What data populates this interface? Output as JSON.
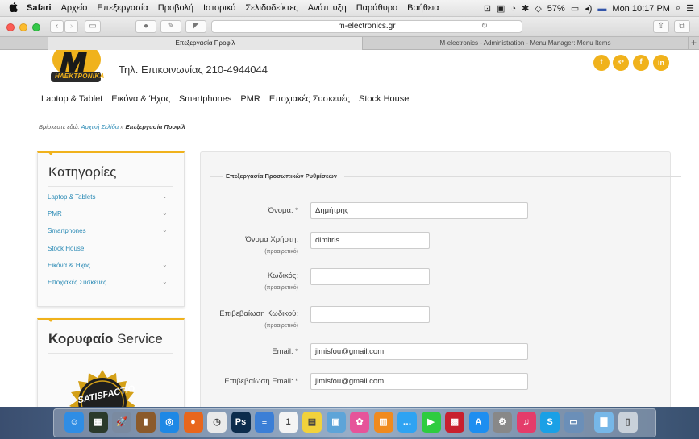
{
  "menubar": {
    "apple": "",
    "items": [
      "Safari",
      "Αρχείο",
      "Επεξεργασία",
      "Προβολή",
      "Ιστορικό",
      "Σελιδοδείκτες",
      "Ανάπτυξη",
      "Παράθυρο",
      "Βοήθεια"
    ],
    "battery": "57%",
    "clock": "Mon 10:17 PM"
  },
  "browser": {
    "url": "m-electronics.gr",
    "tabs": [
      {
        "label": "Επεξεργασία Προφίλ",
        "active": true
      },
      {
        "label": "M-electronics - Administration - Menu Manager: Menu Items",
        "active": false
      }
    ],
    "new_tab": "+"
  },
  "header": {
    "logo_text": "ΗΛΕΚΤΡΟΝΙΚΑ",
    "phone": "Τηλ. Επικοινωνίας 210-4944044",
    "social": [
      {
        "icon": "twitter-icon",
        "glyph": "t"
      },
      {
        "icon": "googleplus-icon",
        "glyph": "8⁺"
      },
      {
        "icon": "facebook-icon",
        "glyph": "f"
      },
      {
        "icon": "linkedin-icon",
        "glyph": "in"
      }
    ]
  },
  "nav": [
    "Laptop & Tablet",
    "Εικόνα & Ήχος",
    "Smartphones",
    "PMR",
    "Εποχιακές Συσκευές",
    "Stock House"
  ],
  "breadcrumb": {
    "prefix": "Βρίσκεστε εδώ:",
    "home": "Αρχική Σελίδα",
    "sep": "»",
    "current": "Επεξεργασία Προφίλ"
  },
  "categories": {
    "title": "Κατηγορίες",
    "items": [
      {
        "label": "Laptop & Tablets",
        "expandable": true
      },
      {
        "label": "PMR",
        "expandable": true
      },
      {
        "label": "Smartphones",
        "expandable": true
      },
      {
        "label": "Stock House",
        "expandable": false
      },
      {
        "label": "Εικόνα & Ήχος",
        "expandable": true
      },
      {
        "label": "Εποχιακές Συσκευές",
        "expandable": true
      }
    ]
  },
  "service": {
    "title_bold": "Κορυφαίο",
    "title_rest": " Service",
    "badge_text": "SATISFACTIO"
  },
  "form": {
    "legend": "Επεξεργασία Προσωπικών Ρυθμίσεων",
    "fields": [
      {
        "label": "Όνομα: *",
        "hint": "",
        "value": "Δημήτρης"
      },
      {
        "label": "Όνομα Χρήστη:",
        "hint": "(προαιρετικό)",
        "value": "dimitris"
      },
      {
        "label": "Κωδικός:",
        "hint": "(προαιρετικό)",
        "value": ""
      },
      {
        "label": "Επιβεβαίωση Κωδικού:",
        "hint": "(προαιρετικό)",
        "value": ""
      },
      {
        "label": "Email: *",
        "hint": "",
        "value": "jimisfou@gmail.com"
      },
      {
        "label": "Επιβεβαίωση Email: *",
        "hint": "",
        "value": "jimisfou@gmail.com"
      }
    ]
  },
  "colors": {
    "accent": "#f0b21c",
    "link": "#2a8ab5"
  },
  "dock": {
    "apps": [
      {
        "name": "finder-icon",
        "glyph": "☺",
        "color": "#2f8de4"
      },
      {
        "name": "activity-monitor-icon",
        "glyph": "▦",
        "color": "#2b3a2b"
      },
      {
        "name": "launchpad-icon",
        "glyph": "🚀",
        "color": "#7a8aa0"
      },
      {
        "name": "notes-book-icon",
        "glyph": "▮",
        "color": "#8b5a2b"
      },
      {
        "name": "safari-icon",
        "glyph": "◎",
        "color": "#1e88e5"
      },
      {
        "name": "firefox-icon",
        "glyph": "●",
        "color": "#e8661c"
      },
      {
        "name": "clock-icon",
        "glyph": "◷",
        "color": "#eaeaea"
      },
      {
        "name": "photoshop-icon",
        "glyph": "Ps",
        "color": "#0c2c4c"
      },
      {
        "name": "notes-icon",
        "glyph": "≡",
        "color": "#3c7fd6"
      },
      {
        "name": "calendar-icon",
        "glyph": "1",
        "color": "#f4f4f4"
      },
      {
        "name": "stickies-icon",
        "glyph": "▤",
        "color": "#f1d23c"
      },
      {
        "name": "preview-icon",
        "glyph": "▣",
        "color": "#5da4d8"
      },
      {
        "name": "photos-icon",
        "glyph": "✿",
        "color": "#e6549a"
      },
      {
        "name": "ibooks-icon",
        "glyph": "▥",
        "color": "#f08a1e"
      },
      {
        "name": "messages-icon",
        "glyph": "…",
        "color": "#2ea3f2"
      },
      {
        "name": "facetime-icon",
        "glyph": "▶",
        "color": "#2ecc40"
      },
      {
        "name": "photo-booth-icon",
        "glyph": "▩",
        "color": "#c8202e"
      },
      {
        "name": "app-store-icon",
        "glyph": "A",
        "color": "#1d8ef0"
      },
      {
        "name": "system-preferences-icon",
        "glyph": "⚙",
        "color": "#888888"
      },
      {
        "name": "itunes-icon",
        "glyph": "♫",
        "color": "#e43c6a"
      },
      {
        "name": "skype-icon",
        "glyph": "S",
        "color": "#1aa0e6"
      },
      {
        "name": "screenshot-icon",
        "glyph": "▭",
        "color": "#6b8fb8"
      },
      {
        "name": "downloads-folder-icon",
        "glyph": "▇",
        "color": "#76b7e8"
      },
      {
        "name": "trash-icon",
        "glyph": "▯",
        "color": "#c9d1da"
      }
    ]
  }
}
